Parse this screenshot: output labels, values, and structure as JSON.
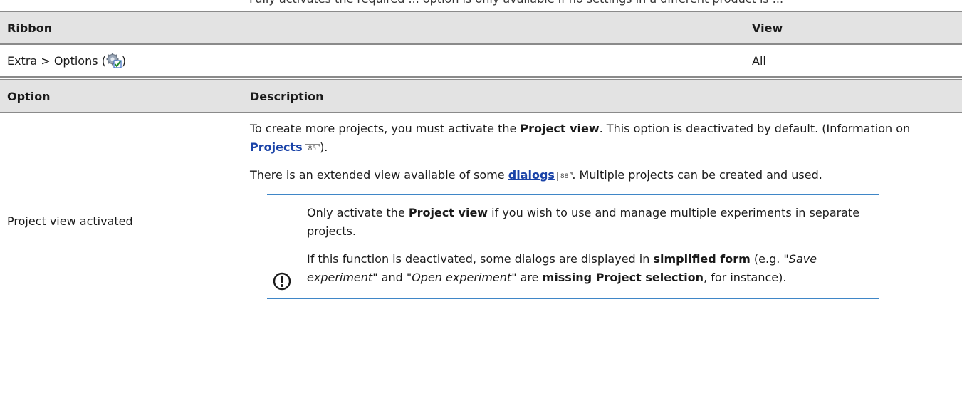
{
  "cut_text": "Fully activates the required ... option is only available if no settings in a different product is ...",
  "ribbon_table": {
    "headers": [
      "Ribbon",
      "View"
    ],
    "row": {
      "path_prefix": "Extra > Options (",
      "path_suffix": ")",
      "view": "All"
    },
    "icon": "gear-checkmark-icon"
  },
  "option_table": {
    "headers": [
      "Option",
      "Description"
    ],
    "option_name": "Project view activated",
    "desc": {
      "p1_a": "To create more projects, you must activate the ",
      "p1_b": "Project view",
      "p1_c": ". This option is deactivated by default. (Information on ",
      "p1_link": "Projects",
      "p1_ref": "85",
      "p1_d": ").",
      "p2_a": "There is an extended view available of some ",
      "p2_link": "dialogs",
      "p2_ref": "88",
      "p2_b": ". Multiple projects can be created and used."
    },
    "note": {
      "icon": "exclamation-circle-icon",
      "n1_a": "Only activate the ",
      "n1_b": "Project view",
      "n1_c": " if you wish to use and manage multiple experiments in separate projects.",
      "n2_a": "If this function is deactivated, some dialogs are displayed in ",
      "n2_b": "simplified form",
      "n2_c": " (e.g. \"",
      "n2_d": "Save experiment",
      "n2_e": "\" and \"",
      "n2_f": "Open experiment",
      "n2_g": "\" are ",
      "n2_h": "missing Project selection",
      "n2_i": ", for instance)."
    },
    "colors": {
      "accent_line": "#3f86c7",
      "header_bg": "#e3e3e3",
      "link": "#1a43a8"
    }
  }
}
